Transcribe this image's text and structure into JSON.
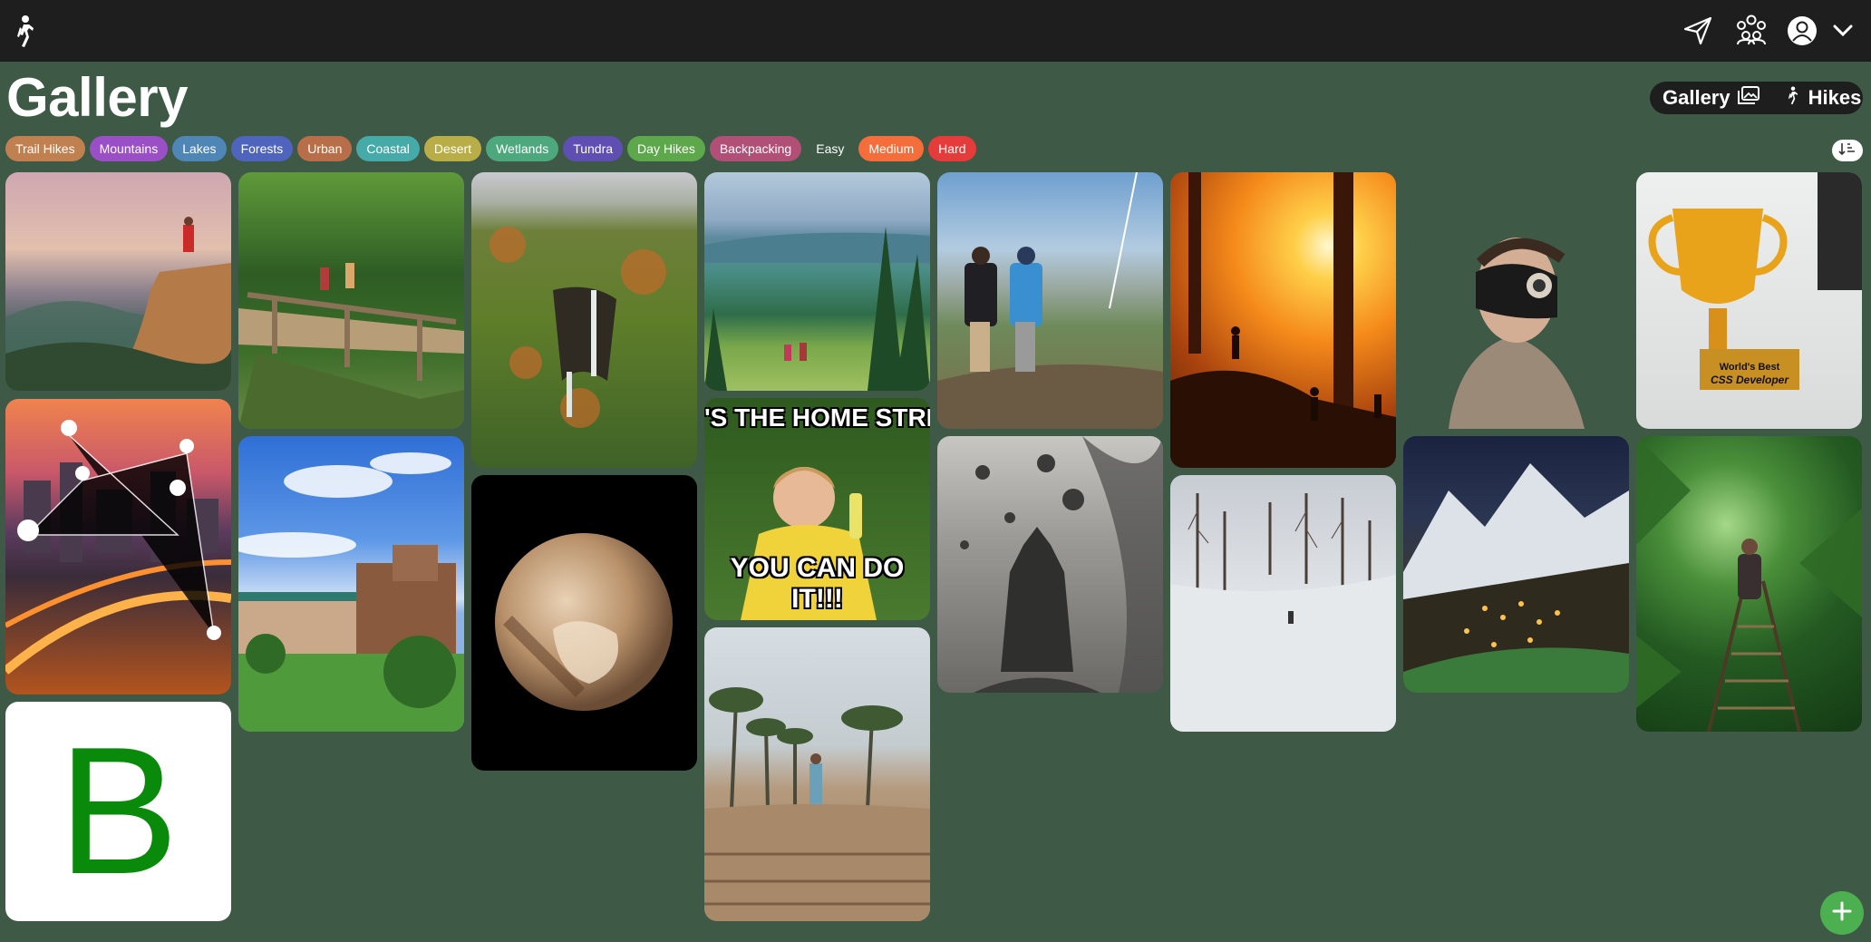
{
  "header": {
    "logo_icon": "hiker-icon",
    "nav_icons": [
      "send-icon",
      "community-icon",
      "account-icon",
      "chevron-down-icon"
    ]
  },
  "page": {
    "title": "Gallery"
  },
  "view_toggle": {
    "gallery_label": "Gallery",
    "hikes_label": "Hikes"
  },
  "tags": [
    {
      "label": "Trail Hikes",
      "color": "#c0804f"
    },
    {
      "label": "Mountains",
      "color": "#9b4fc6"
    },
    {
      "label": "Lakes",
      "color": "#4e86b6"
    },
    {
      "label": "Forests",
      "color": "#4f64bd"
    },
    {
      "label": "Urban",
      "color": "#b86f49"
    },
    {
      "label": "Coastal",
      "color": "#46aaa8"
    },
    {
      "label": "Desert",
      "color": "#b9ad47"
    },
    {
      "label": "Wetlands",
      "color": "#4ea87d"
    },
    {
      "label": "Tundra",
      "color": "#5f4fb3"
    },
    {
      "label": "Day Hikes",
      "color": "#5ea84c"
    },
    {
      "label": "Backpacking",
      "color": "#b24f76"
    },
    {
      "label": "Easy",
      "color": "transparent"
    },
    {
      "label": "Medium",
      "color": "#f56d3a"
    },
    {
      "label": "Hard",
      "color": "#e63b3b"
    }
  ],
  "gallery": {
    "meme_top_text": "'S THE HOME STRETCH",
    "meme_bottom_text": "YOU CAN DO IT!!!",
    "letter_tile_text": "B",
    "trophy_text_1": "World's Best",
    "trophy_text_2": "CSS Developer"
  },
  "colors": {
    "background": "#3f5947",
    "topbar": "#1e1e1e",
    "fab": "#4caf50",
    "letter": "#0a8a0a"
  }
}
